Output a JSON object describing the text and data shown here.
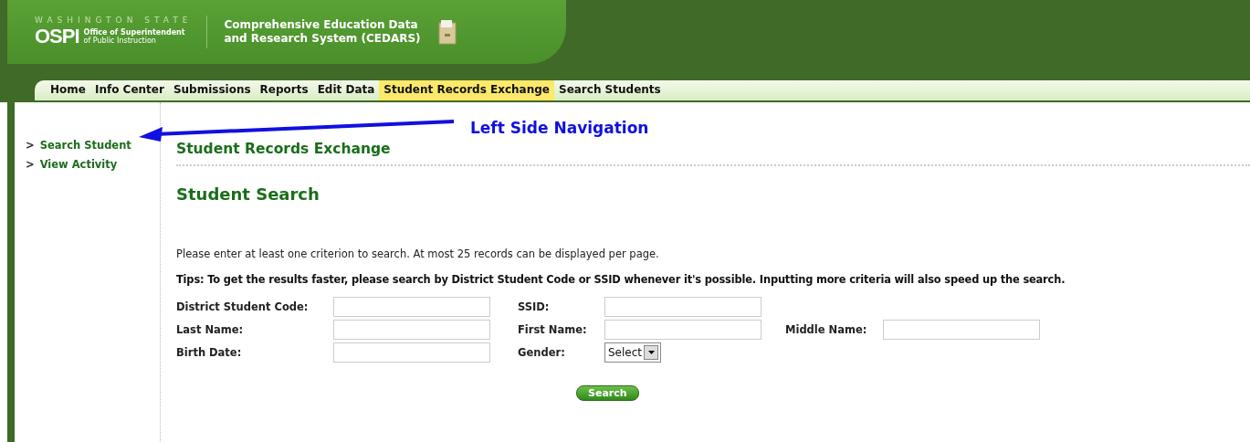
{
  "header": {
    "state_label": "WASHINGTON STATE",
    "logo": "OSPI",
    "agency_line_1": "Office of Superintendent",
    "agency_line_2": "of Public Instruction",
    "system_line_1": "Comprehensive Education Data",
    "system_line_2": "and Research System (CEDARS)"
  },
  "nav": [
    {
      "label": "Home",
      "selected": false
    },
    {
      "label": "Info Center",
      "selected": false
    },
    {
      "label": "Submissions",
      "selected": false
    },
    {
      "label": "Reports",
      "selected": false
    },
    {
      "label": "Edit Data",
      "selected": false
    },
    {
      "label": "Student Records Exchange",
      "selected": true
    },
    {
      "label": "Search Students",
      "selected": false
    }
  ],
  "sidebar": {
    "items": [
      {
        "marker": ">",
        "label": "Search Student"
      },
      {
        "marker": ">",
        "label": "View Activity"
      }
    ]
  },
  "annotation": {
    "label": "Left Side Navigation"
  },
  "page_title": "Student Records Exchange",
  "section_title": "Student Search",
  "instructions": "Please enter at least one criterion to search. At most 25 records can be displayed per page.",
  "tips": "Tips: To get the results faster, please search by District Student Code or SSID whenever it's possible. Inputting more criteria will also speed up the search.",
  "form_rows": [
    [
      {
        "label": "District Student Code:",
        "kind": "text"
      },
      {
        "label": "SSID:",
        "kind": "text"
      }
    ],
    [
      {
        "label": "Last Name:",
        "kind": "text"
      },
      {
        "label": "First Name:",
        "kind": "text"
      },
      {
        "label": "Middle Name:",
        "kind": "text"
      }
    ],
    [
      {
        "label": "Birth Date:",
        "kind": "text"
      },
      {
        "label": "Gender:",
        "kind": "select",
        "value": "Select"
      }
    ]
  ],
  "search_button": "Search"
}
